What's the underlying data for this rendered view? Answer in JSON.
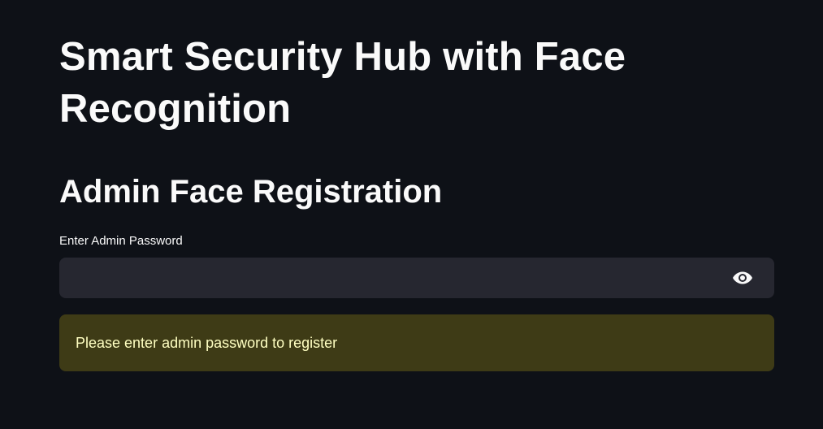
{
  "header": {
    "title": "Smart Security Hub with Face Recognition"
  },
  "registration": {
    "heading": "Admin Face Registration",
    "password_label": "Enter Admin Password",
    "password_value": "",
    "password_placeholder": "",
    "toggle_icon": "eye-icon"
  },
  "alert": {
    "message": "Please enter admin password to register",
    "kind": "warning"
  },
  "colors": {
    "background": "#0e1117",
    "input_background": "#262730",
    "warning_background": "#3e3b16",
    "warning_text": "#ffffc2",
    "text": "#fafafa"
  }
}
